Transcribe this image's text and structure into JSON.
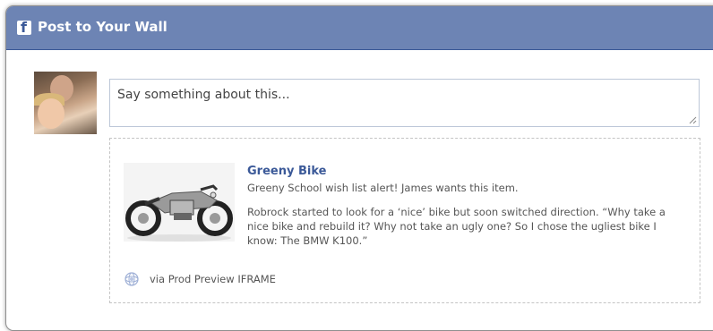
{
  "dialog": {
    "title": "Post to Your Wall",
    "icon": "facebook-icon"
  },
  "composer": {
    "placeholder": "Say something about this..."
  },
  "attachment": {
    "title": "Greeny Bike",
    "caption": "Greeny School wish list alert! James wants this item.",
    "description": "Robrock started to look for a ‘nice’ bike but soon switched direction. “Why take a nice bike and rebuild it? Why not take an ugly one? So I chose the ugliest bike I know: The BMW K100.”",
    "via": "via Prod Preview IFRAME",
    "via_icon": "app-gear-icon"
  },
  "colors": {
    "titlebar": "#6d84b4",
    "link": "#3b5998"
  }
}
